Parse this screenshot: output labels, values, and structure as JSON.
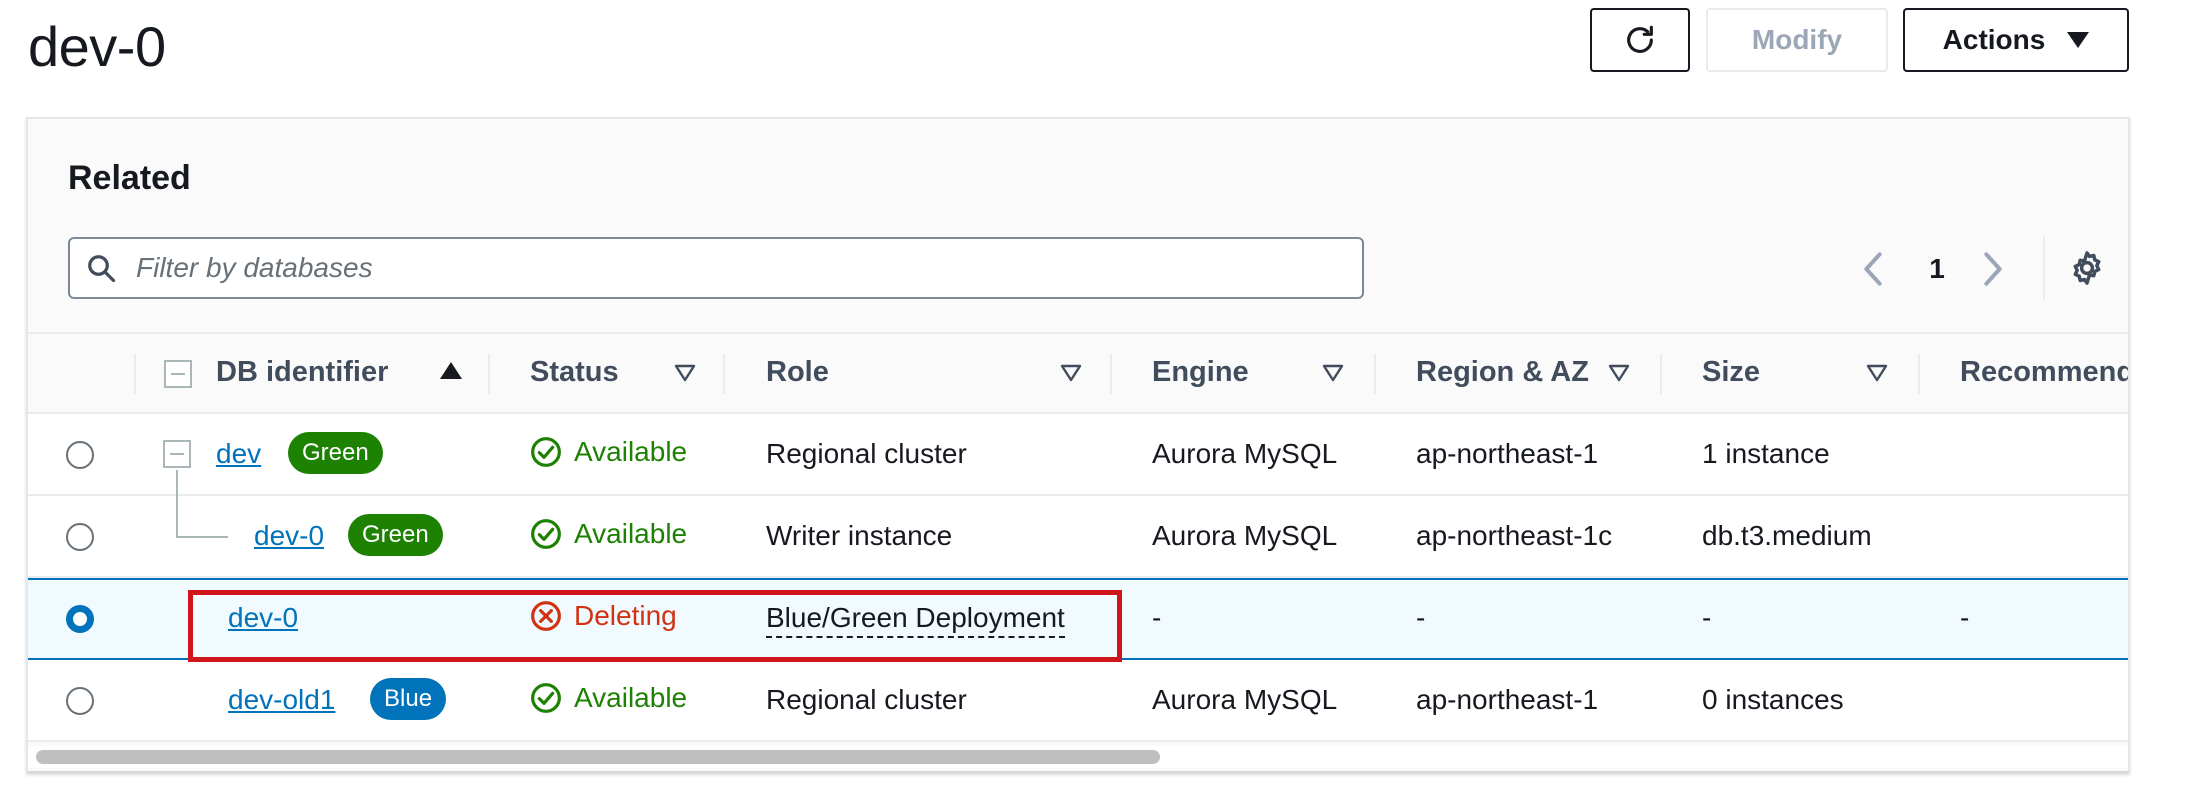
{
  "page": {
    "title": "dev-0"
  },
  "toolbar": {
    "modify_label": "Modify",
    "actions_label": "Actions"
  },
  "related": {
    "title": "Related",
    "search": {
      "placeholder": "Filter by databases",
      "value": ""
    },
    "pagination": {
      "current_page": "1"
    }
  },
  "table": {
    "columns": [
      "DB identifier",
      "Status",
      "Role",
      "Engine",
      "Region & AZ",
      "Size",
      "Recommenda"
    ],
    "rows": [
      {
        "selected": false,
        "identifier": "dev",
        "badge": "Green",
        "status": "Available",
        "role": "Regional cluster",
        "engine": "Aurora MySQL",
        "region": "ap-northeast-1",
        "size": "1 instance",
        "recommendation": ""
      },
      {
        "selected": false,
        "identifier": "dev-0",
        "badge": "Green",
        "status": "Available",
        "role": "Writer instance",
        "engine": "Aurora MySQL",
        "region": "ap-northeast-1c",
        "size": "db.t3.medium",
        "recommendation": ""
      },
      {
        "selected": true,
        "identifier": "dev-0",
        "badge": "",
        "status": "Deleting",
        "role": "Blue/Green Deployment",
        "engine": "-",
        "region": "-",
        "size": "-",
        "recommendation": "-"
      },
      {
        "selected": false,
        "identifier": "dev-old1",
        "badge": "Blue",
        "status": "Available",
        "role": "Regional cluster",
        "engine": "Aurora MySQL",
        "region": "ap-northeast-1",
        "size": "0 instances",
        "recommendation": ""
      }
    ]
  },
  "icons": {
    "refresh": "refresh-icon",
    "search": "search-icon",
    "settings": "gear-icon",
    "status_ok": "check-circle-icon",
    "status_error": "x-circle-icon"
  },
  "colors": {
    "link": "#0073bb",
    "success": "#1d8102",
    "error": "#d13212",
    "selected_row": "#f1faff",
    "highlight": "#d0161b"
  }
}
